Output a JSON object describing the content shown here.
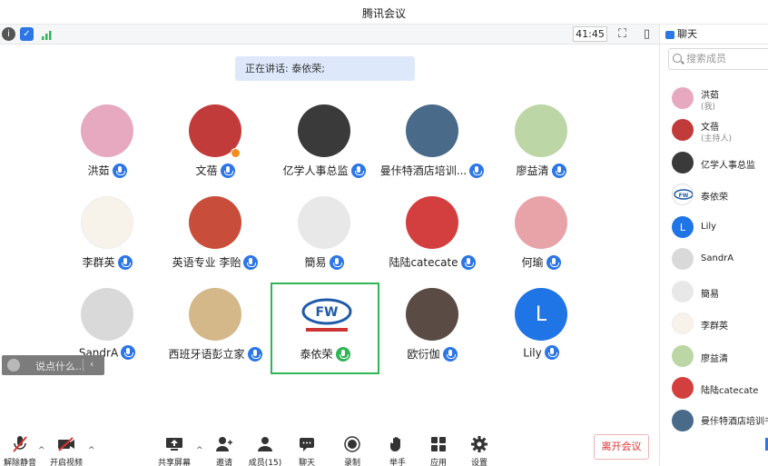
{
  "window": {
    "title": "腾讯会议"
  },
  "topbar": {
    "timer": "41:45",
    "info_icon": "info-icon",
    "shield_icon": "shield-icon",
    "signal_icon": "signal-icon"
  },
  "speaking": {
    "text": "正在讲话: 泰依荣;"
  },
  "participants": [
    {
      "name": "洪茹",
      "avatar_color": "#e6a9c0"
    },
    {
      "name": "文蓓",
      "avatar_color": "#c23b3b",
      "host": true
    },
    {
      "name": "亿学人事总监",
      "avatar_color": "#3a3a3a"
    },
    {
      "name": "曼佧特酒店培训...",
      "avatar_color": "#4a6a8a"
    },
    {
      "name": "廖益清",
      "avatar_color": "#bcd6a6"
    },
    {
      "name": "李群英",
      "avatar_color": "#f7f2ea"
    },
    {
      "name": "英语专业 李贻",
      "avatar_color": "#c84d3a"
    },
    {
      "name": "簡易",
      "avatar_color": "#e8e8e8"
    },
    {
      "name": "陆陆catecate",
      "avatar_color": "#d33f3f"
    },
    {
      "name": "何瑜",
      "avatar_color": "#e8a3a8"
    },
    {
      "name": "SandrA",
      "avatar_color": "#d9d9d9"
    },
    {
      "name": "西班牙语彭立家",
      "avatar_color": "#d4b88a"
    },
    {
      "name": "泰依荣",
      "avatar_color": "#ffffff",
      "active": true
    },
    {
      "name": "欧衍伽",
      "avatar_color": "#5a4b44"
    },
    {
      "name": "Lily",
      "avatar_color": "#1f74e6",
      "initial": "L"
    }
  ],
  "chat_input": {
    "placeholder": "说点什么..."
  },
  "bottombar": {
    "unmute": "解除静音",
    "video": "开启视频",
    "share": "共享屏幕",
    "invite": "邀请",
    "members": "成员(15)",
    "chat": "聊天",
    "record": "录制",
    "raise_hand": "举手",
    "apps": "应用",
    "settings": "设置",
    "leave": "离开会议"
  },
  "panel": {
    "title": "聊天",
    "search_placeholder": "搜索成员",
    "members": [
      {
        "name": "洪茹",
        "role": "(我)",
        "color": "#e6a9c0"
      },
      {
        "name": "文蓓",
        "role": "(主持人)",
        "color": "#c23b3b"
      },
      {
        "name": "亿学人事总监",
        "color": "#3a3a3a"
      },
      {
        "name": "泰依荣",
        "color": "#ffffff"
      },
      {
        "name": "Lily",
        "color": "#1f74e6",
        "initial": "L"
      },
      {
        "name": "SandrA",
        "color": "#d9d9d9"
      },
      {
        "name": "簡易",
        "color": "#e8e8e8"
      },
      {
        "name": "李群英",
        "color": "#f7f2ea"
      },
      {
        "name": "廖益清",
        "color": "#bcd6a6"
      },
      {
        "name": "陆陆catecate",
        "color": "#d33f3f"
      },
      {
        "name": "曼佧特酒店培训书",
        "color": "#4a6a8a"
      }
    ]
  }
}
